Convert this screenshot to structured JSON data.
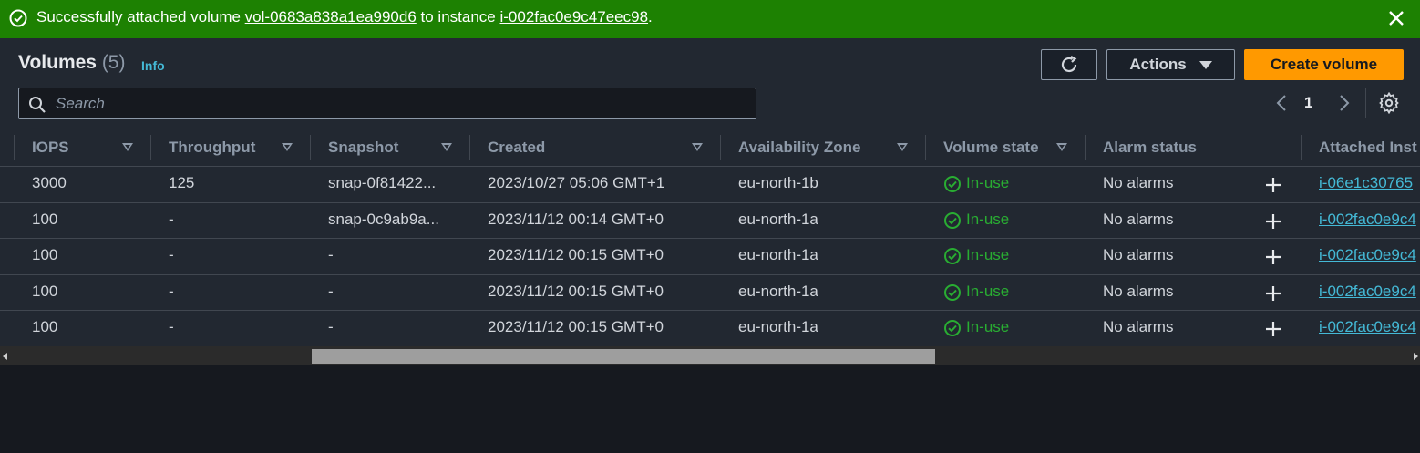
{
  "flash": {
    "prefix": "Successfully attached volume ",
    "volume_id": "vol-0683a838a1ea990d6",
    "middle": " to instance ",
    "instance_id": "i-002fac0e9c47eec98",
    "suffix": ".",
    "color": "#1d8102"
  },
  "header": {
    "title": "Volumes",
    "count": "(5)",
    "info_label": "Info",
    "actions_label": "Actions",
    "create_label": "Create volume"
  },
  "search": {
    "placeholder": "Search",
    "value": ""
  },
  "pagination": {
    "current_page": "1"
  },
  "columns": {
    "iops": "IOPS",
    "throughput": "Throughput",
    "snapshot": "Snapshot",
    "created": "Created",
    "az": "Availability Zone",
    "state": "Volume state",
    "alarm": "Alarm status",
    "attached": "Attached Inst"
  },
  "rows": [
    {
      "iops": "3000",
      "throughput": "125",
      "snapshot": "snap-0f81422...",
      "created": "2023/10/27 05:06 GMT+1",
      "az": "eu-north-1b",
      "state": "In-use",
      "alarm": "No alarms",
      "attached": "i-06e1c30765"
    },
    {
      "iops": "100",
      "throughput": "-",
      "snapshot": "snap-0c9ab9a...",
      "created": "2023/11/12 00:14 GMT+0",
      "az": "eu-north-1a",
      "state": "In-use",
      "alarm": "No alarms",
      "attached": "i-002fac0e9c4"
    },
    {
      "iops": "100",
      "throughput": "-",
      "snapshot": "-",
      "created": "2023/11/12 00:15 GMT+0",
      "az": "eu-north-1a",
      "state": "In-use",
      "alarm": "No alarms",
      "attached": "i-002fac0e9c4"
    },
    {
      "iops": "100",
      "throughput": "-",
      "snapshot": "-",
      "created": "2023/11/12 00:15 GMT+0",
      "az": "eu-north-1a",
      "state": "In-use",
      "alarm": "No alarms",
      "attached": "i-002fac0e9c4"
    },
    {
      "iops": "100",
      "throughput": "-",
      "snapshot": "-",
      "created": "2023/11/12 00:15 GMT+0",
      "az": "eu-north-1a",
      "state": "In-use",
      "alarm": "No alarms",
      "attached": "i-002fac0e9c4"
    }
  ],
  "colors": {
    "primary_button": "#ff9900",
    "link": "#44b9d6",
    "success": "#29ad32",
    "background": "#16191f"
  },
  "icons": {
    "flash": "check-circle-icon",
    "close": "close-icon",
    "refresh": "refresh-icon",
    "search": "search-icon",
    "settings": "gear-icon",
    "state": "check-circle-icon",
    "alarm_add": "plus-icon"
  }
}
